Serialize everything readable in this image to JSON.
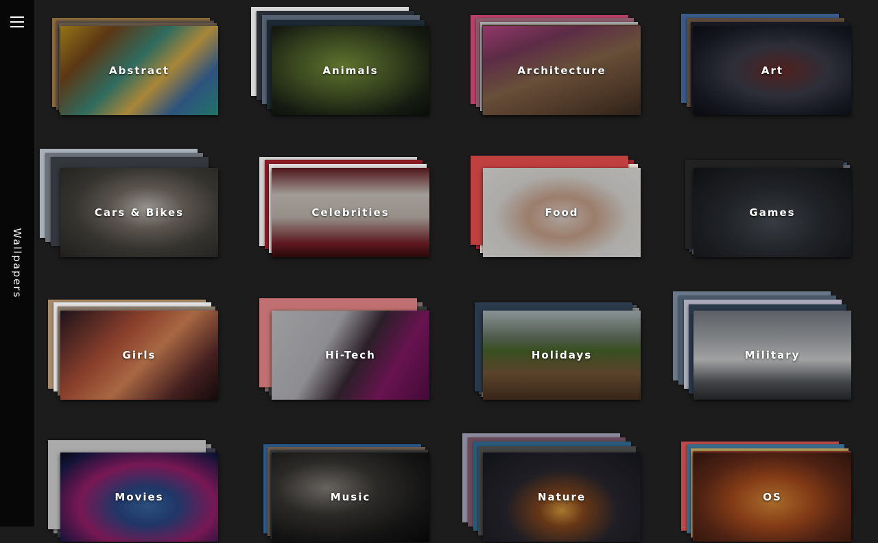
{
  "sidebar": {
    "title": "Wallpapers",
    "menu_icon": "hamburger-menu-icon"
  },
  "categories": [
    {
      "label": "Abstract",
      "front": "linear-gradient(135deg,#c49a20 0%,#7a4a1c 22%,#3f8f7e 45%,#e1b44a 62%,#3d6fa8 80%,#2a9c8a 100%)",
      "stack": [
        "#8a6a3a",
        "#5a4f44",
        "#6a5a4a"
      ]
    },
    {
      "label": "Animals",
      "front": "radial-gradient(ellipse at 45% 45%,#7f9a3e 0%,#4d5f2a 40%,#1e2618 75%,#0d120c 100%)",
      "stack": [
        "#d7d7d7",
        "#2a2f36",
        "#556070",
        "#1d2a33"
      ]
    },
    {
      "label": "Architecture",
      "front": "linear-gradient(160deg,#c24a8c 0%,#7c3b5e 25%,#8a6a4c 50%,#6a4c36 75%,#3e2e22 100%)",
      "stack": [
        "#b8406a",
        "#8a5a6a",
        "#aaa",
        "#5a3a2e"
      ]
    },
    {
      "label": "Art",
      "front": "radial-gradient(ellipse at 55% 50%,#6b2c2a 0%,#3c3e4c 40%,#1a1e28 75%,#0e1016 100%)",
      "stack": [
        "#3a5a8a",
        "#5a4a3a",
        "#1a1a24"
      ]
    },
    {
      "label": "Cars & Bikes",
      "front": "radial-gradient(ellipse at 55% 45%,#c9c5c0 0%,#7a7068 30%,#46453f 60%,#2c2a26 100%)",
      "stack": [
        "#aab0b8",
        "#6c7078",
        "#34383c"
      ]
    },
    {
      "label": "Celebrities",
      "front": "linear-gradient(180deg,#6a1e24 0%,#d8d0c8 30%,#c8c0b6 55%,#7a2028 85%,#3a0c10 100%)",
      "stack": [
        "#d0d0d0",
        "#8a1a24",
        "#e0e0e0"
      ]
    },
    {
      "label": "Food",
      "front": "radial-gradient(ellipse at 50% 55%,#e8d8d0 0%,#d0a890 30%,#e6e4e0 60%,#f0efec 100%)",
      "stack": [
        "#d0c8c0",
        "#a02030",
        "#e8dcd0",
        "#c04040"
      ]
    },
    {
      "label": "Games",
      "front": "radial-gradient(ellipse at 50% 60%,#4a5058 0%,#2a2e34 45%,#141618 100%)",
      "stack": [
        "#8a3a5a",
        "#3a4a6a",
        "#6a6a70",
        "#222"
      ]
    },
    {
      "label": "Girls",
      "front": "linear-gradient(135deg,#2a1a24 0%,#b8543a 35%,#e08a5a 55%,#5a2a2a 80%,#1a0e10 100%)",
      "stack": [
        "#a88a6a",
        "#e0e0e0",
        "#8a7a6a"
      ]
    },
    {
      "label": "Hi-Tech",
      "front": "linear-gradient(120deg,#cfcfd2 0%,#bdbdc2 35%,#3a2a36 55%,#8a1a6a 75%,#5a0e4a 100%)",
      "stack": [
        "#e0e0e0",
        "#7a6a6a",
        "#3a3a3a",
        "#c07070"
      ]
    },
    {
      "label": "Holidays",
      "front": "linear-gradient(180deg,#b8c4c8 0%,#6a7a66 30%,#4a6a2a 45%,#7a5a3a 70%,#4a3220 100%)",
      "stack": [
        "#c0b090",
        "#4a4e5a",
        "#8a8a8a",
        "#2a3a4a"
      ]
    },
    {
      "label": "Military",
      "front": "linear-gradient(180deg,#7a8088 0%,#a8acb0 30%,#d8d8d8 55%,#5a5e62 80%,#2a2c2e 100%)",
      "stack": [
        "#6a7a8a",
        "#4a5a6a",
        "#aab",
        "#2a3a4a"
      ]
    },
    {
      "label": "Movies",
      "front": "radial-gradient(ellipse at 55% 60%,#3a6aa8 0%,#2a4a8a 25%,#a02070 55%,#1a1a4a 85%,#0a0a1a 100%)",
      "stack": [
        "#c0c0c0",
        "#8a8a8a",
        "#3a3a4a",
        "#aaa"
      ]
    },
    {
      "label": "Music",
      "front": "radial-gradient(ellipse at 35% 40%,#8a8680 0%,#3a3834 35%,#1a1a1a 70%,#0a0a0a 100%)",
      "stack": [
        "#2a5a8a",
        "#6a5a4a",
        "#3a3a3a"
      ]
    },
    {
      "label": "Nature",
      "front": "radial-gradient(ellipse at 50% 65%,#e0a040 0%,#8a4a1e 20%,#2a2830 50%,#181a22 100%)",
      "stack": [
        "#8a8a9a",
        "#6a4a5a",
        "#2a5a7a",
        "#444"
      ]
    },
    {
      "label": "OS",
      "front": "radial-gradient(ellipse at 50% 55%,#e0903a 0%,#b0501e 35%,#6a2e1a 65%,#3a1a10 100%)",
      "stack": [
        "#c04a4a",
        "#3a6a8a",
        "#b09a5a",
        "#8a3a2a"
      ]
    }
  ]
}
